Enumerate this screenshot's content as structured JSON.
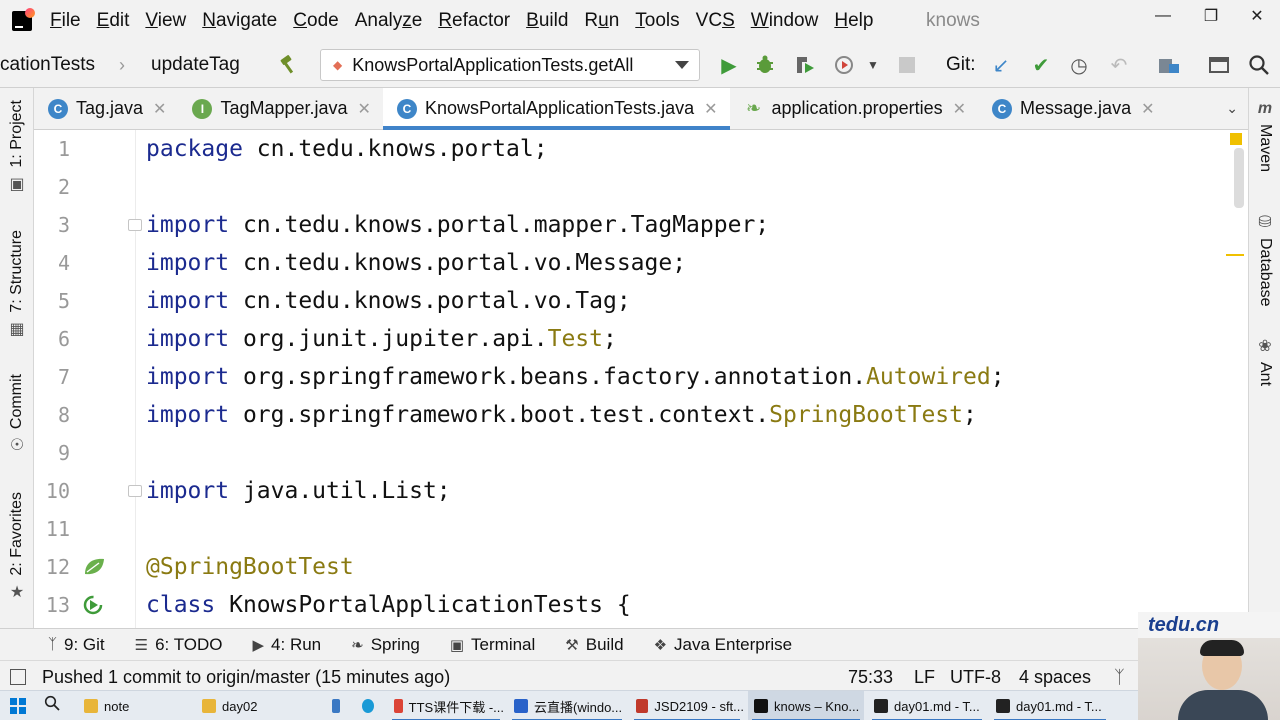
{
  "menubar": {
    "items": [
      {
        "label": "File",
        "mnemonic": "F"
      },
      {
        "label": "Edit",
        "mnemonic": "E"
      },
      {
        "label": "View",
        "mnemonic": "V"
      },
      {
        "label": "Navigate",
        "mnemonic": "N"
      },
      {
        "label": "Code",
        "mnemonic": "C"
      },
      {
        "label": "Analyze",
        "mnemonic": "z"
      },
      {
        "label": "Refactor",
        "mnemonic": "R"
      },
      {
        "label": "Build",
        "mnemonic": "B"
      },
      {
        "label": "Run",
        "mnemonic": "u"
      },
      {
        "label": "Tools",
        "mnemonic": "T"
      },
      {
        "label": "VCS",
        "mnemonic": "S"
      },
      {
        "label": "Window",
        "mnemonic": "W"
      },
      {
        "label": "Help",
        "mnemonic": "H"
      }
    ],
    "window_title": "knows"
  },
  "toolbar": {
    "breadcrumb_1": "cationTests",
    "breadcrumb_2": "updateTag",
    "run_config": "KnowsPortalApplicationTests.getAll",
    "git_label": "Git:"
  },
  "tabs": [
    {
      "label": "Tag.java",
      "icon": "C",
      "color": "#3e86c8",
      "active": false
    },
    {
      "label": "TagMapper.java",
      "icon": "I",
      "color": "#6aa84f",
      "active": false
    },
    {
      "label": "KnowsPortalApplicationTests.java",
      "icon": "C",
      "color": "#3e86c8",
      "active": true
    },
    {
      "label": "application.properties",
      "icon": "leaf",
      "color": "#6aa84f",
      "active": false
    },
    {
      "label": "Message.java",
      "icon": "C",
      "color": "#3e86c8",
      "active": false
    }
  ],
  "left_tools": {
    "project": "1: Project",
    "structure": "7: Structure",
    "commit": "Commit",
    "favorites": "2: Favorites"
  },
  "right_tools": {
    "maven": "Maven",
    "database": "Database",
    "ant": "Ant"
  },
  "editor": {
    "lines": [
      {
        "n": "1",
        "kw": "package",
        "rest": " cn.tedu.knows.portal;",
        "hl": ""
      },
      {
        "n": "2",
        "kw": "",
        "rest": "",
        "hl": ""
      },
      {
        "n": "3",
        "kw": "import",
        "rest": " cn.tedu.knows.portal.mapper.TagMapper;",
        "hl": ""
      },
      {
        "n": "4",
        "kw": "import",
        "rest": " cn.tedu.knows.portal.vo.Message;",
        "hl": ""
      },
      {
        "n": "5",
        "kw": "import",
        "rest": " cn.tedu.knows.portal.vo.Tag;",
        "hl": ""
      },
      {
        "n": "6",
        "kw": "import",
        "rest": " org.junit.jupiter.api.",
        "hl": "Test",
        "tail": ";"
      },
      {
        "n": "7",
        "kw": "import",
        "rest": " org.springframework.beans.factory.annotation.",
        "hl": "Autowired",
        "tail": ";"
      },
      {
        "n": "8",
        "kw": "import",
        "rest": " org.springframework.boot.test.context.",
        "hl": "SpringBootTest",
        "tail": ";"
      },
      {
        "n": "9",
        "kw": "",
        "rest": "",
        "hl": ""
      },
      {
        "n": "10",
        "kw": "import",
        "rest": " java.util.List;",
        "hl": ""
      },
      {
        "n": "11",
        "kw": "",
        "rest": "",
        "hl": ""
      },
      {
        "n": "12",
        "kw": "",
        "rest": "",
        "hl": "@SpringBootTest"
      },
      {
        "n": "13",
        "kw": "class",
        "rest": " KnowsPortalApplicationTests {",
        "hl": ""
      }
    ]
  },
  "toolwindows": [
    {
      "label": "9: Git",
      "icon": "git-branch-icon"
    },
    {
      "label": "6: TODO",
      "icon": "list-icon"
    },
    {
      "label": "4: Run",
      "icon": "play-icon"
    },
    {
      "label": "Spring",
      "icon": "spring-leaf-icon"
    },
    {
      "label": "Terminal",
      "icon": "terminal-icon"
    },
    {
      "label": "Build",
      "icon": "hammer-icon"
    },
    {
      "label": "Java Enterprise",
      "icon": "java-enterprise-icon"
    }
  ],
  "status": {
    "message": "Pushed 1 commit to origin/master (15 minutes ago)",
    "position": "75:33",
    "line_sep": "LF",
    "encoding": "UTF-8",
    "indent": "4 spaces"
  },
  "taskbar": {
    "items": [
      {
        "label": "note",
        "color": "#e8b53a"
      },
      {
        "label": "day02",
        "color": "#e8b53a"
      },
      {
        "label": "TTS课件下载 -...",
        "color": "#db4437"
      },
      {
        "label": "云直播(windo...",
        "color": "#2962c9"
      },
      {
        "label": "JSD2109 - sft...",
        "color": "#c0392b"
      },
      {
        "label": "knows – Kno...",
        "color": "#111111"
      },
      {
        "label": "day01.md - T...",
        "color": "#222222"
      },
      {
        "label": "day01.md - T...",
        "color": "#222222"
      }
    ]
  },
  "webcam": {
    "banner": "tedu.cn"
  }
}
